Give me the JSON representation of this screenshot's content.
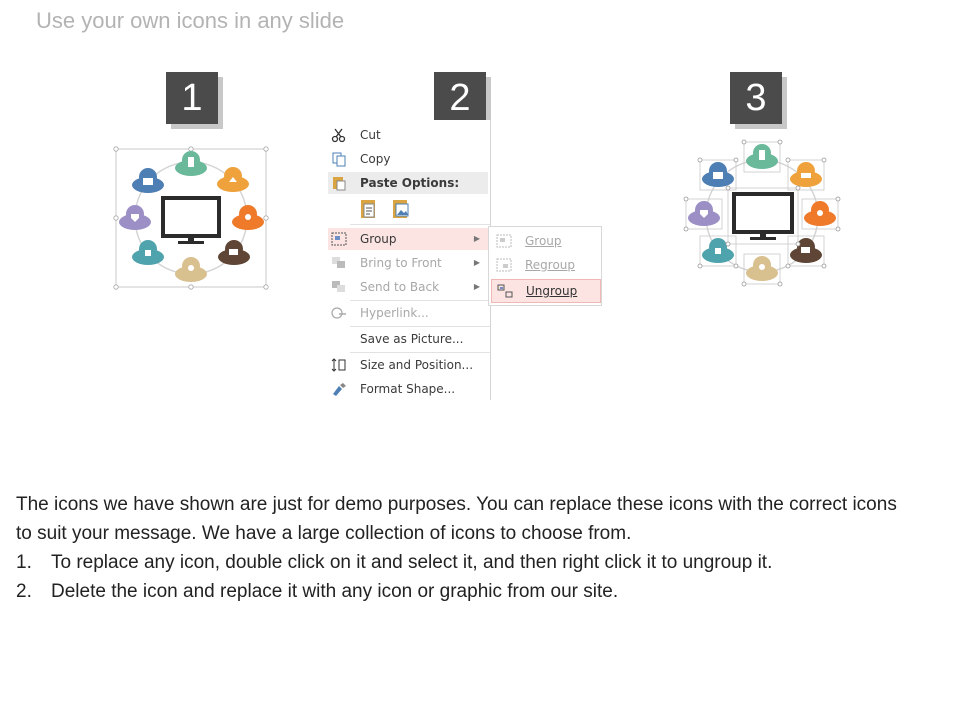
{
  "slide": {
    "title": "Use your own icons in any slide",
    "steps": [
      "1",
      "2",
      "3"
    ]
  },
  "context_menu": {
    "items": [
      {
        "label": "Cut",
        "icon": "scissors-icon",
        "state": "enabled"
      },
      {
        "label": "Copy",
        "icon": "copy-icon",
        "state": "enabled"
      },
      {
        "label": "Paste Options:",
        "icon": "paste-icon",
        "state": "header"
      },
      {
        "label": "Group",
        "icon": "group-icon",
        "state": "highlighted",
        "submenu": true
      },
      {
        "label": "Bring to Front",
        "icon": "bring-front-icon",
        "state": "disabled",
        "submenu": true
      },
      {
        "label": "Send to Back",
        "icon": "send-back-icon",
        "state": "disabled",
        "submenu": true
      },
      {
        "label": "Hyperlink...",
        "icon": "hyperlink-icon",
        "state": "disabled"
      },
      {
        "label": "Save as Picture...",
        "icon": "",
        "state": "enabled"
      },
      {
        "label": "Size and Position...",
        "icon": "size-position-icon",
        "state": "enabled"
      },
      {
        "label": "Format Shape...",
        "icon": "format-shape-icon",
        "state": "enabled"
      }
    ]
  },
  "submenu": {
    "items": [
      {
        "label": "Group",
        "icon": "group-icon",
        "state": "disabled"
      },
      {
        "label": "Regroup",
        "icon": "regroup-icon",
        "state": "disabled"
      },
      {
        "label": "Ungroup",
        "icon": "ungroup-icon",
        "state": "highlighted"
      }
    ]
  },
  "body": {
    "intro": "The icons we have shown are just for demo purposes. You can replace these icons with the correct icons to suit your message. We have a large collection of icons to choose from.",
    "steps": [
      {
        "num": "1.",
        "text": "To replace any icon, double click on it and select it, and then right click it to ungroup it."
      },
      {
        "num": "2.",
        "text": "Delete the icon and replace it with any icon or graphic from our site."
      }
    ]
  },
  "colors": {
    "cloud_green": "#6ab99a",
    "cloud_orange": "#efa23c",
    "cloud_orange_dark": "#ee7a2a",
    "cloud_brown": "#5e4535",
    "cloud_tan": "#d9c08f",
    "cloud_teal": "#4fa3ad",
    "cloud_purple": "#9b8fc6",
    "cloud_blue": "#4d7fb4",
    "menu_highlight": "#fbe4e2"
  }
}
